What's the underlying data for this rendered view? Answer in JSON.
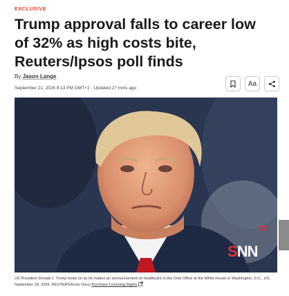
{
  "article": {
    "tag": "EXCLUSIVE",
    "headline": "Trump approval falls to career low of 32% as high costs bite, Reuters/Ipsos poll finds",
    "byline_prefix": "By",
    "author": "Jason Lange",
    "timestamp": "September 21, 2026 8:13 PM GMT+2",
    "updated": "· Updated 27 mins ago"
  },
  "toolbar": {
    "bookmark_icon": "bookmark-icon",
    "text_size_label": "Aa",
    "share_icon": "share-icon"
  },
  "image": {
    "watermark_tv": "TV",
    "watermark_s": "S",
    "watermark_nn": "NN"
  },
  "caption": {
    "text": "US President Donald J. Trump looks on as he makes an announcement on healthcare in the Oval Office at the White House in Washington, D.C., US, September 18, 2026. REUTERS/Evan Vucci",
    "license_link": "Purchase Licensing Rights",
    "external_icon": "external-link-icon"
  },
  "colors": {
    "accent": "#e8401c",
    "watermark_red": "#e23030"
  }
}
